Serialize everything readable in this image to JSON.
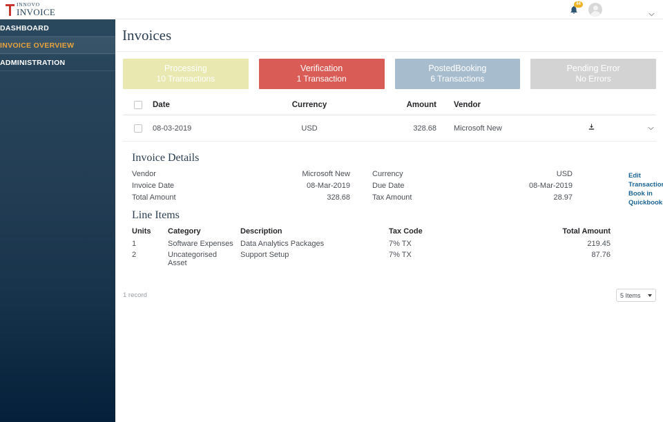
{
  "brand": {
    "logo_line1": "INNOVO",
    "logo_line2": "INVOICE",
    "accent_color": "#c8352f"
  },
  "sidebar": {
    "items": [
      {
        "label": "DASHBOARD",
        "active": false
      },
      {
        "label": "INVOICE OVERVIEW",
        "active": true
      },
      {
        "label": "ADMINISTRATION",
        "active": false
      }
    ]
  },
  "topbar": {
    "notification_count": "44",
    "bell_icon": "bell-icon",
    "avatar_icon": "user-avatar-icon",
    "caret_icon": "chevron-down-icon"
  },
  "header": {
    "title": "Invoices"
  },
  "status_cards": [
    {
      "title": "Processing",
      "subtitle": "10 Transactions",
      "color": "#e8e8b0"
    },
    {
      "title": "Verification",
      "subtitle": "1 Transaction",
      "color": "#da5c56"
    },
    {
      "title": "PostedBooking",
      "subtitle": "6 Transactions",
      "color": "#a7bccd"
    },
    {
      "title": "Pending Error",
      "subtitle": "No Errors",
      "color": "#d3d3d3"
    }
  ],
  "invoice_table": {
    "columns": [
      "Date",
      "Currency",
      "Amount",
      "Vendor"
    ],
    "rows": [
      {
        "date": "08-03-2019",
        "currency": "USD",
        "amount": "328.68",
        "vendor": "Microsoft New",
        "download_icon": "download-icon",
        "expand_icon": "chevron-down-icon"
      }
    ]
  },
  "invoice_details": {
    "heading": "Invoice Details",
    "fields": [
      {
        "label": "Vendor",
        "value": "Microsoft New"
      },
      {
        "label": "Currency",
        "value": "USD"
      },
      {
        "label": "Invoice Date",
        "value": "08-Mar-2019"
      },
      {
        "label": "Due Date",
        "value": "08-Mar-2019"
      },
      {
        "label": "Total Amount",
        "value": "328.68"
      },
      {
        "label": "Tax Amount",
        "value": "28.97"
      }
    ],
    "actions": [
      {
        "label": "Edit Transaction"
      },
      {
        "label": "Book in Quickbooks"
      }
    ],
    "link_color": "#1a6496"
  },
  "line_items": {
    "heading": "Line Items",
    "columns": [
      "Units",
      "Category",
      "Description",
      "Tax Code",
      "Total Amount"
    ],
    "rows": [
      {
        "units": "1",
        "category": "Software Expenses",
        "description": "Data Analytics Packages",
        "tax_code": "7% TX",
        "total_amount": "219.45"
      },
      {
        "units": "2",
        "category": "Uncategorised Asset",
        "description": "Support Setup",
        "tax_code": "7% TX",
        "total_amount": "87.76"
      }
    ]
  },
  "footer": {
    "record_count": "1 record",
    "page_size_value": "5 Items"
  }
}
